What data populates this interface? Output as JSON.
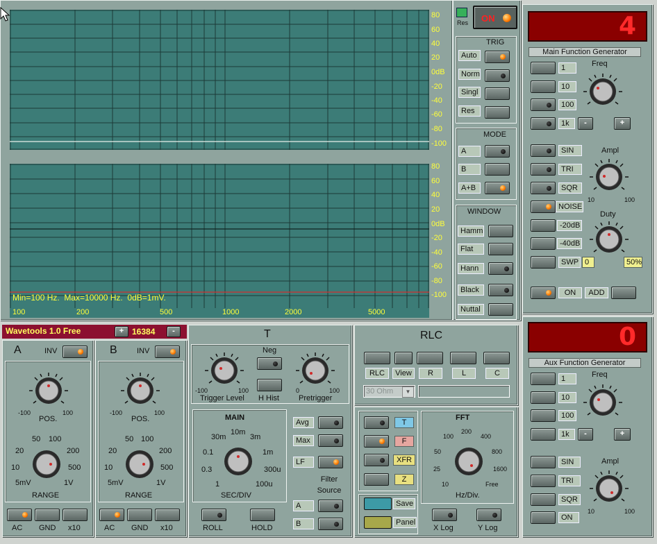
{
  "display": {
    "y_labels": [
      "80",
      "60",
      "40",
      "20",
      "0dB",
      "-20",
      "-40",
      "-60",
      "-80",
      "-100"
    ],
    "x_labels": [
      "100",
      "200",
      "500",
      "1000",
      "2000",
      "5000"
    ],
    "status_text": "Min=100 Hz.  Max=10000 Hz.  0dB=1mV."
  },
  "power": {
    "res_label": "Res",
    "on_label": "ON"
  },
  "trig": {
    "title": "TRIG",
    "items": [
      "Auto",
      "Norm",
      "Singl",
      "Res"
    ]
  },
  "mode": {
    "title": "MODE",
    "items": [
      "A",
      "B",
      "A+B"
    ]
  },
  "window": {
    "title": "WINDOW",
    "items": [
      "Hamm",
      "Flat",
      "Hann",
      "Black",
      "Nuttal"
    ]
  },
  "main_gen": {
    "display": "4",
    "title": "Main Function Generator",
    "freq_label": "Freq",
    "ranges": [
      "1",
      "10",
      "100",
      "1k"
    ],
    "minus": "-",
    "plus": "+",
    "waves": [
      "SIN",
      "TRI",
      "SQR",
      "NOISE",
      "-20dB",
      "-40dB",
      "SWP"
    ],
    "swp_value": "0",
    "ampl_label": "Ampl",
    "ampl_min": "10",
    "ampl_max": "100",
    "duty_label": "Duty",
    "duty_value": "50%",
    "on_label": "ON",
    "add_label": "ADD"
  },
  "aux_gen": {
    "display": "0",
    "title": "Aux Function Generator",
    "freq_label": "Freq",
    "ranges": [
      "1",
      "10",
      "100",
      "1k"
    ],
    "minus": "-",
    "plus": "+",
    "waves": [
      "SIN",
      "TRI",
      "SQR",
      "ON"
    ],
    "ampl_label": "Ampl",
    "ampl_min": "10",
    "ampl_max": "100"
  },
  "app_bar": {
    "title": "Wavetools 1.0 Free",
    "plus": "+",
    "value": "16384",
    "minus": "-"
  },
  "chan_a": {
    "name": "A",
    "inv": "INV",
    "pos_label": "POS.",
    "pos_min": "-100",
    "pos_max": "100",
    "range_label": "RANGE",
    "range_ticks": [
      "50",
      "100",
      "20",
      "200",
      "10",
      "500",
      "5mV",
      "1V"
    ],
    "buttons": [
      "AC",
      "GND",
      "x10"
    ]
  },
  "chan_b": {
    "name": "B",
    "inv": "INV",
    "pos_label": "POS.",
    "pos_min": "-100",
    "pos_max": "100",
    "range_label": "RANGE",
    "range_ticks": [
      "50",
      "100",
      "20",
      "200",
      "10",
      "500",
      "5mV",
      "1V"
    ],
    "buttons": [
      "AC",
      "GND",
      "x10"
    ]
  },
  "time": {
    "title": "T",
    "neg": "Neg",
    "hhist": "H Hist",
    "trig_level": "Trigger Level",
    "tl_min": "-100",
    "tl_max": "100",
    "pretrigger": "Pretrigger",
    "pt_min": "0",
    "pt_max": "100",
    "main": "MAIN",
    "sec_div": "SEC/DIV",
    "sec_ticks": [
      "30m",
      "10m",
      "3m",
      "0.1",
      "1m",
      "0.3",
      "300u",
      "1",
      "100u"
    ],
    "avg": "Avg",
    "max": "Max",
    "lf": "LF",
    "filter_source": "Filter Source",
    "src_a": "A",
    "src_b": "B",
    "roll": "ROLL",
    "hold": "HOLD"
  },
  "rlc": {
    "title": "RLC",
    "buttons": [
      "RLC",
      "View",
      "R",
      "L",
      "C"
    ],
    "select_value": "30 Ohm"
  },
  "fft": {
    "tabs": [
      "T",
      "F",
      "XFR",
      "Z"
    ],
    "save": "Save",
    "panel": "Panel",
    "title": "FFT",
    "hz_div": "Hz/Div.",
    "ticks": [
      "200",
      "100",
      "400",
      "50",
      "800",
      "25",
      "1600",
      "10",
      "Free"
    ],
    "xlog": "X Log",
    "ylog": "Y Log"
  }
}
